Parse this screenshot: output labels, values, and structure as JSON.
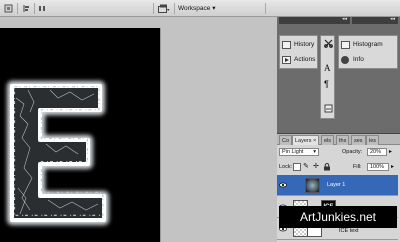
{
  "toolbar": {
    "workspace_label": "Workspace ▾"
  },
  "dock": {
    "collapse_arrows_left": "◂◂",
    "collapse_arrows_right": "◂◂",
    "col1_items": [
      {
        "label": "History",
        "icon": "history-icon"
      },
      {
        "label": "Actions",
        "icon": "actions-icon"
      }
    ],
    "col2_items": [
      {
        "label": "Histogram",
        "icon": "histogram-icon"
      },
      {
        "label": "Info",
        "icon": "info-icon"
      }
    ]
  },
  "layers": {
    "tabs": [
      "Co",
      "Layers ×",
      "els",
      "ths",
      "ses",
      "les"
    ],
    "blend_mode": "Pin Light",
    "opacity_label": "Opacity:",
    "opacity_value": "20%",
    "lock_label": "Lock:",
    "fill_label": "Fill:",
    "fill_value": "100%",
    "rows": [
      {
        "name": "Layer 1",
        "selected": true
      },
      {
        "name": "",
        "selected": false
      },
      {
        "name": "ICE text",
        "selected": false
      }
    ],
    "thumb_text": "ICE"
  },
  "watermark": {
    "text": "ArtJunkies.net"
  },
  "canvas": {
    "letter": "E"
  }
}
